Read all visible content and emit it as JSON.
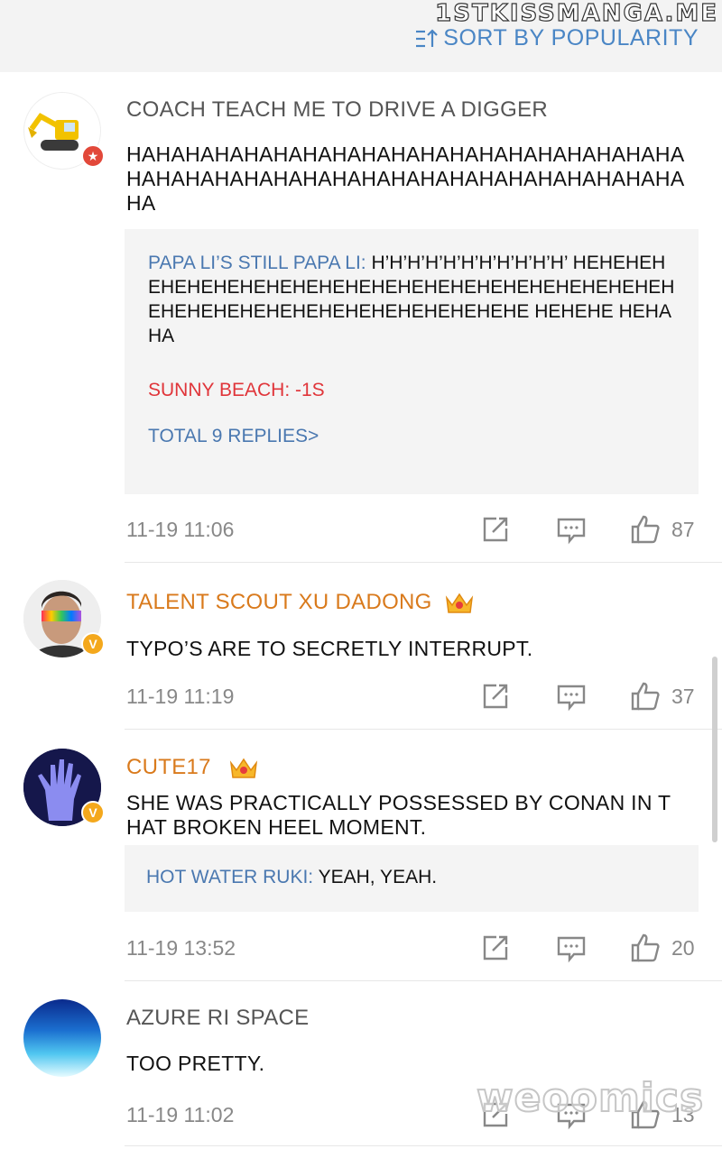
{
  "watermark_top": "1STKISSMANGA.ME",
  "header": {
    "sort_label": "SORT BY POPULARITY"
  },
  "comments": [
    {
      "user": "COACH TEACH ME TO DRIVE A DIGGER",
      "text": "HAHAHAHAHAHAHAHAHAHAHAHAHAHAHAHAHAHAHAHAHAHAHAHAHAHAHAHAHAHAHAHAHAHAHAHAHAHAHA",
      "replies": [
        {
          "name": "PAPA LI’S STILL PAPA LI:",
          "text": " H’H’H’H’H’H’H’H’H’H’H’ HEHEHEHEHEHEHEHEHEHEHEHEHEHEHEHEHEHEHEHEHEHEHEHEHEHEHEHEHEHEHEHEHEHEHEHEHEHE HEHEHE HEHAHA"
        },
        {
          "name": "SUNNY BEACH: -1S",
          "text": ""
        }
      ],
      "total_replies": "TOTAL 9 REPLIES>",
      "time": "11-19 11:06",
      "likes": "87",
      "badge": "red-shield"
    },
    {
      "user": "TALENT SCOUT XU DADONG",
      "text": "TYPO’S ARE TO SECRETLY INTERRUPT.",
      "time": "11-19 11:19",
      "likes": "37",
      "badge": "gold-v"
    },
    {
      "user": "CUTE17",
      "text": "SHE WAS PRACTICALLY POSSESSED BY CONAN IN THAT BROKEN HEEL MOMENT.",
      "replies": [
        {
          "name": "HOT WATER RUKI:",
          "text": " YEAH, YEAH."
        }
      ],
      "time": "11-19 13:52",
      "likes": "20",
      "badge": "gold-v"
    },
    {
      "user": "AZURE RI SPACE",
      "text": "TOO PRETTY.",
      "time": "11-19 11:02",
      "likes": "13"
    }
  ],
  "watermark_bottom": "weoomics",
  "colors": {
    "link_blue": "#4a78b0",
    "vip_orange": "#d97a1c",
    "reply_red": "#e0353a",
    "meta_grey": "#888888"
  }
}
